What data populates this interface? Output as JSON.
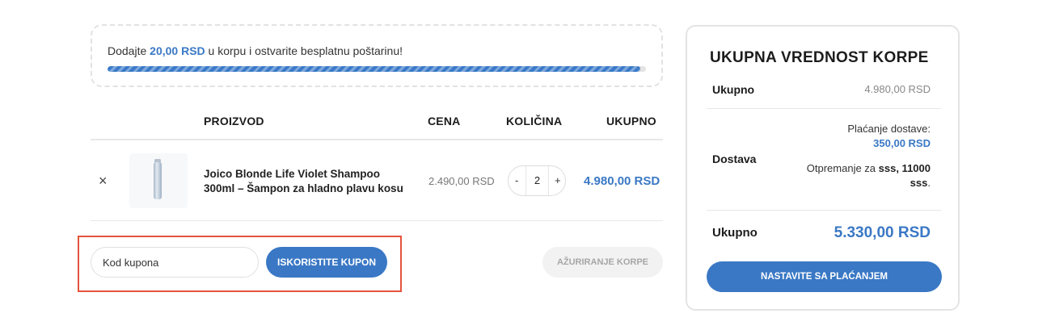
{
  "notice": {
    "prefix": "Dodajte ",
    "amount": "20,00 RSD",
    "suffix": " u korpu i ostvarite besplatnu poštarinu!",
    "progress_percent": 99,
    "progress_color": "#3a7ac8"
  },
  "cart": {
    "headers": {
      "product": "PROIZVOD",
      "price": "CENA",
      "quantity": "KOLIČINA",
      "total": "UKUPNO"
    },
    "items": [
      {
        "remove_symbol": "×",
        "thumbnail_icon": "shampoo-bottle-image",
        "name": "Joico Blonde Life Violet Shampoo 300ml – Šampon za hladno plavu kosu",
        "price": "2.490,00 RSD",
        "quantity": "2",
        "minus": "-",
        "plus": "+",
        "line_total": "4.980,00 RSD"
      }
    ]
  },
  "coupon": {
    "placeholder": "Kod kupona",
    "apply_label": "ISKORISTITE KUPON",
    "update_label": "AŽURIRANJE KORPE"
  },
  "totals": {
    "title": "UKUPNA VREDNOST KORPE",
    "subtotal_label": "Ukupno",
    "subtotal_value": "4.980,00 RSD",
    "shipping_label": "Dostava",
    "shipping_text": "Plaćanje dostave:",
    "shipping_cost": "350,00 RSD",
    "shipping_to_prefix": "Otpremanje za ",
    "shipping_to_city": "sss, 11000",
    "shipping_to_country": "sss",
    "shipping_to_suffix": ".",
    "total_label": "Ukupno",
    "total_value": "5.330,00 RSD",
    "checkout_label": "NASTAVITE SA PLAĆANJEM"
  },
  "colors": {
    "accent": "#3a78c5",
    "highlight_border": "#e5533d"
  }
}
